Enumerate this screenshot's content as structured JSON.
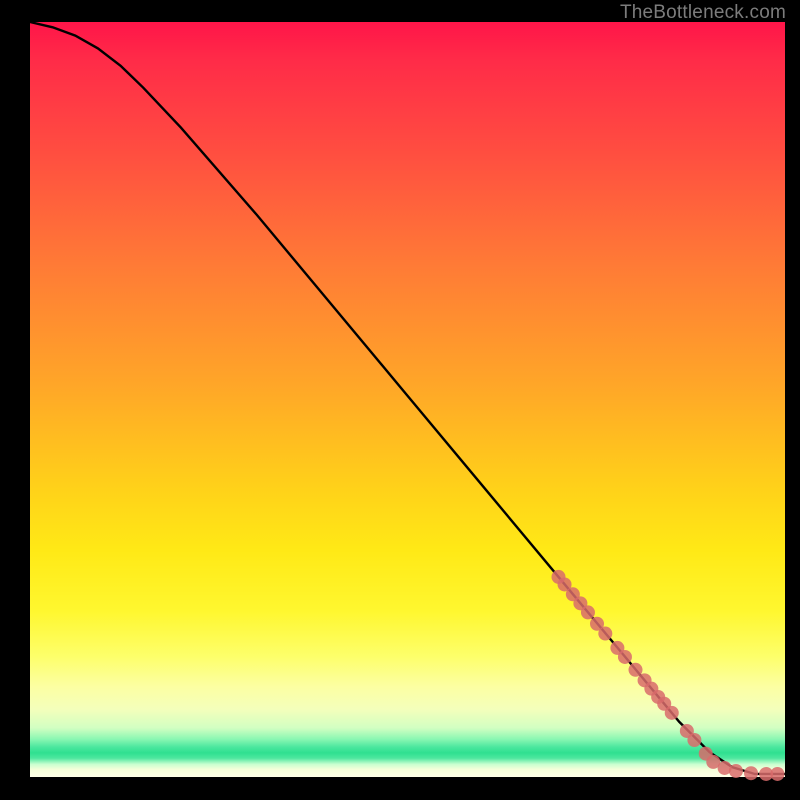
{
  "attribution": "TheBottleneck.com",
  "chart_data": {
    "type": "line",
    "title": "",
    "xlabel": "",
    "ylabel": "",
    "xlim": [
      0,
      100
    ],
    "ylim": [
      0,
      100
    ],
    "series": [
      {
        "name": "curve",
        "color": "#000000",
        "x": [
          0,
          3,
          6,
          9,
          12,
          15,
          20,
          30,
          40,
          50,
          60,
          70,
          80,
          86,
          90,
          93,
          96,
          100
        ],
        "y": [
          100,
          99.3,
          98.2,
          96.5,
          94.2,
          91.3,
          86,
          74.5,
          62.5,
          50.5,
          38.5,
          26.5,
          14.5,
          7.3,
          3.3,
          1.3,
          0.4,
          0.4
        ]
      },
      {
        "name": "dots",
        "color": "#d86b6b",
        "type": "scatter",
        "x": [
          70.0,
          70.8,
          71.9,
          72.9,
          73.9,
          75.1,
          76.2,
          77.8,
          78.8,
          80.2,
          81.4,
          82.3,
          83.2,
          84.0,
          85.0,
          87.0,
          88.0,
          89.5,
          90.5,
          92.0,
          93.5,
          95.5,
          97.5,
          99.0
        ],
        "y": [
          26.5,
          25.5,
          24.2,
          23.0,
          21.8,
          20.3,
          19.0,
          17.1,
          15.9,
          14.2,
          12.8,
          11.7,
          10.6,
          9.7,
          8.5,
          6.1,
          4.9,
          3.1,
          2.0,
          1.2,
          0.8,
          0.5,
          0.4,
          0.4
        ]
      }
    ]
  }
}
